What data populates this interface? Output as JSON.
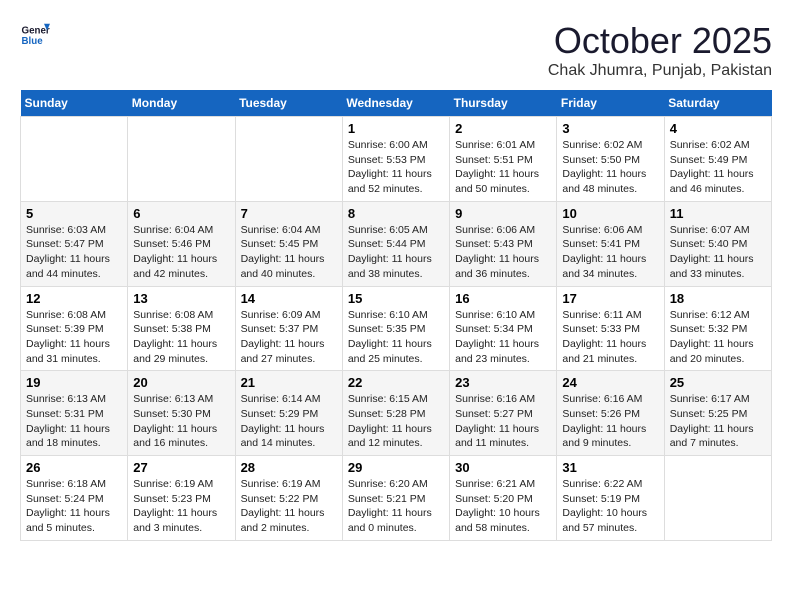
{
  "header": {
    "logo_line1": "General",
    "logo_line2": "Blue",
    "month": "October 2025",
    "location": "Chak Jhumra, Punjab, Pakistan"
  },
  "weekdays": [
    "Sunday",
    "Monday",
    "Tuesday",
    "Wednesday",
    "Thursday",
    "Friday",
    "Saturday"
  ],
  "weeks": [
    [
      {
        "day": "",
        "info": ""
      },
      {
        "day": "",
        "info": ""
      },
      {
        "day": "",
        "info": ""
      },
      {
        "day": "1",
        "info": "Sunrise: 6:00 AM\nSunset: 5:53 PM\nDaylight: 11 hours\nand 52 minutes."
      },
      {
        "day": "2",
        "info": "Sunrise: 6:01 AM\nSunset: 5:51 PM\nDaylight: 11 hours\nand 50 minutes."
      },
      {
        "day": "3",
        "info": "Sunrise: 6:02 AM\nSunset: 5:50 PM\nDaylight: 11 hours\nand 48 minutes."
      },
      {
        "day": "4",
        "info": "Sunrise: 6:02 AM\nSunset: 5:49 PM\nDaylight: 11 hours\nand 46 minutes."
      }
    ],
    [
      {
        "day": "5",
        "info": "Sunrise: 6:03 AM\nSunset: 5:47 PM\nDaylight: 11 hours\nand 44 minutes."
      },
      {
        "day": "6",
        "info": "Sunrise: 6:04 AM\nSunset: 5:46 PM\nDaylight: 11 hours\nand 42 minutes."
      },
      {
        "day": "7",
        "info": "Sunrise: 6:04 AM\nSunset: 5:45 PM\nDaylight: 11 hours\nand 40 minutes."
      },
      {
        "day": "8",
        "info": "Sunrise: 6:05 AM\nSunset: 5:44 PM\nDaylight: 11 hours\nand 38 minutes."
      },
      {
        "day": "9",
        "info": "Sunrise: 6:06 AM\nSunset: 5:43 PM\nDaylight: 11 hours\nand 36 minutes."
      },
      {
        "day": "10",
        "info": "Sunrise: 6:06 AM\nSunset: 5:41 PM\nDaylight: 11 hours\nand 34 minutes."
      },
      {
        "day": "11",
        "info": "Sunrise: 6:07 AM\nSunset: 5:40 PM\nDaylight: 11 hours\nand 33 minutes."
      }
    ],
    [
      {
        "day": "12",
        "info": "Sunrise: 6:08 AM\nSunset: 5:39 PM\nDaylight: 11 hours\nand 31 minutes."
      },
      {
        "day": "13",
        "info": "Sunrise: 6:08 AM\nSunset: 5:38 PM\nDaylight: 11 hours\nand 29 minutes."
      },
      {
        "day": "14",
        "info": "Sunrise: 6:09 AM\nSunset: 5:37 PM\nDaylight: 11 hours\nand 27 minutes."
      },
      {
        "day": "15",
        "info": "Sunrise: 6:10 AM\nSunset: 5:35 PM\nDaylight: 11 hours\nand 25 minutes."
      },
      {
        "day": "16",
        "info": "Sunrise: 6:10 AM\nSunset: 5:34 PM\nDaylight: 11 hours\nand 23 minutes."
      },
      {
        "day": "17",
        "info": "Sunrise: 6:11 AM\nSunset: 5:33 PM\nDaylight: 11 hours\nand 21 minutes."
      },
      {
        "day": "18",
        "info": "Sunrise: 6:12 AM\nSunset: 5:32 PM\nDaylight: 11 hours\nand 20 minutes."
      }
    ],
    [
      {
        "day": "19",
        "info": "Sunrise: 6:13 AM\nSunset: 5:31 PM\nDaylight: 11 hours\nand 18 minutes."
      },
      {
        "day": "20",
        "info": "Sunrise: 6:13 AM\nSunset: 5:30 PM\nDaylight: 11 hours\nand 16 minutes."
      },
      {
        "day": "21",
        "info": "Sunrise: 6:14 AM\nSunset: 5:29 PM\nDaylight: 11 hours\nand 14 minutes."
      },
      {
        "day": "22",
        "info": "Sunrise: 6:15 AM\nSunset: 5:28 PM\nDaylight: 11 hours\nand 12 minutes."
      },
      {
        "day": "23",
        "info": "Sunrise: 6:16 AM\nSunset: 5:27 PM\nDaylight: 11 hours\nand 11 minutes."
      },
      {
        "day": "24",
        "info": "Sunrise: 6:16 AM\nSunset: 5:26 PM\nDaylight: 11 hours\nand 9 minutes."
      },
      {
        "day": "25",
        "info": "Sunrise: 6:17 AM\nSunset: 5:25 PM\nDaylight: 11 hours\nand 7 minutes."
      }
    ],
    [
      {
        "day": "26",
        "info": "Sunrise: 6:18 AM\nSunset: 5:24 PM\nDaylight: 11 hours\nand 5 minutes."
      },
      {
        "day": "27",
        "info": "Sunrise: 6:19 AM\nSunset: 5:23 PM\nDaylight: 11 hours\nand 3 minutes."
      },
      {
        "day": "28",
        "info": "Sunrise: 6:19 AM\nSunset: 5:22 PM\nDaylight: 11 hours\nand 2 minutes."
      },
      {
        "day": "29",
        "info": "Sunrise: 6:20 AM\nSunset: 5:21 PM\nDaylight: 11 hours\nand 0 minutes."
      },
      {
        "day": "30",
        "info": "Sunrise: 6:21 AM\nSunset: 5:20 PM\nDaylight: 10 hours\nand 58 minutes."
      },
      {
        "day": "31",
        "info": "Sunrise: 6:22 AM\nSunset: 5:19 PM\nDaylight: 10 hours\nand 57 minutes."
      },
      {
        "day": "",
        "info": ""
      }
    ]
  ]
}
